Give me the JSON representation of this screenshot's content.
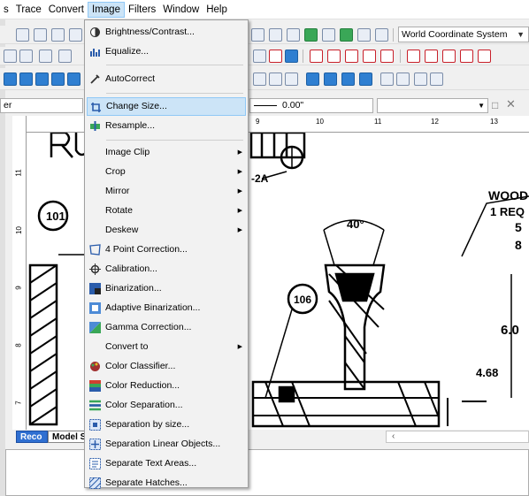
{
  "menubar": {
    "items": [
      {
        "label": "s"
      },
      {
        "label": "Trace"
      },
      {
        "label": "Convert"
      },
      {
        "label": "Image"
      },
      {
        "label": "Filters"
      },
      {
        "label": "Window"
      },
      {
        "label": "Help"
      }
    ]
  },
  "toolbar": {
    "coordinate_system": "World Coordinate System"
  },
  "properties": {
    "layer_value": "er",
    "thickness_value": "0.00\""
  },
  "ruler": {
    "top_labels": [
      "9",
      "10",
      "11",
      "12",
      "13"
    ],
    "left_labels": [
      "11",
      "10",
      "9",
      "8",
      "7"
    ]
  },
  "tabs": [
    {
      "label": "Reco",
      "active": true
    },
    {
      "label": "Model S",
      "active": false
    }
  ],
  "drawing": {
    "labels": [
      "101",
      "106",
      "-2A",
      "40°",
      "WOOD",
      "1 REQ",
      "5",
      "8",
      "6.0",
      "4.68"
    ]
  },
  "image_menu": {
    "items": [
      {
        "label": "Brightness/Contrast...",
        "icon": "brightness-icon",
        "submenu": false
      },
      {
        "label": "Equalize...",
        "icon": "equalize-icon",
        "submenu": false
      },
      {
        "label": "AutoCorrect",
        "icon": "autocorrect-icon",
        "submenu": false
      },
      {
        "label": "Change Size...",
        "icon": "change-size-icon",
        "submenu": false,
        "highlighted": true
      },
      {
        "label": "Resample...",
        "icon": "resample-icon",
        "submenu": false
      },
      {
        "label": "Image Clip",
        "icon": "",
        "submenu": true
      },
      {
        "label": "Crop",
        "icon": "",
        "submenu": true
      },
      {
        "label": "Mirror",
        "icon": "",
        "submenu": true
      },
      {
        "label": "Rotate",
        "icon": "",
        "submenu": true
      },
      {
        "label": "Deskew",
        "icon": "",
        "submenu": true
      },
      {
        "label": "4 Point Correction...",
        "icon": "four-point-icon",
        "submenu": false
      },
      {
        "label": "Calibration...",
        "icon": "calibration-icon",
        "submenu": false
      },
      {
        "label": "Binarization...",
        "icon": "binarization-icon",
        "submenu": false
      },
      {
        "label": "Adaptive Binarization...",
        "icon": "adaptive-binarization-icon",
        "submenu": false
      },
      {
        "label": "Gamma Correction...",
        "icon": "gamma-icon",
        "submenu": false
      },
      {
        "label": "Convert to",
        "icon": "",
        "submenu": true
      },
      {
        "label": "Color Classifier...",
        "icon": "color-classifier-icon",
        "submenu": false
      },
      {
        "label": "Color Reduction...",
        "icon": "color-reduction-icon",
        "submenu": false
      },
      {
        "label": "Color Separation...",
        "icon": "color-separation-icon",
        "submenu": false
      },
      {
        "label": "Separation by size...",
        "icon": "separation-size-icon",
        "submenu": false
      },
      {
        "label": "Separation Linear Objects...",
        "icon": "separation-linear-icon",
        "submenu": false
      },
      {
        "label": "Separate Text Areas...",
        "icon": "separate-text-icon",
        "submenu": false
      },
      {
        "label": "Separate Hatches...",
        "icon": "separate-hatches-icon",
        "submenu": false
      }
    ]
  }
}
